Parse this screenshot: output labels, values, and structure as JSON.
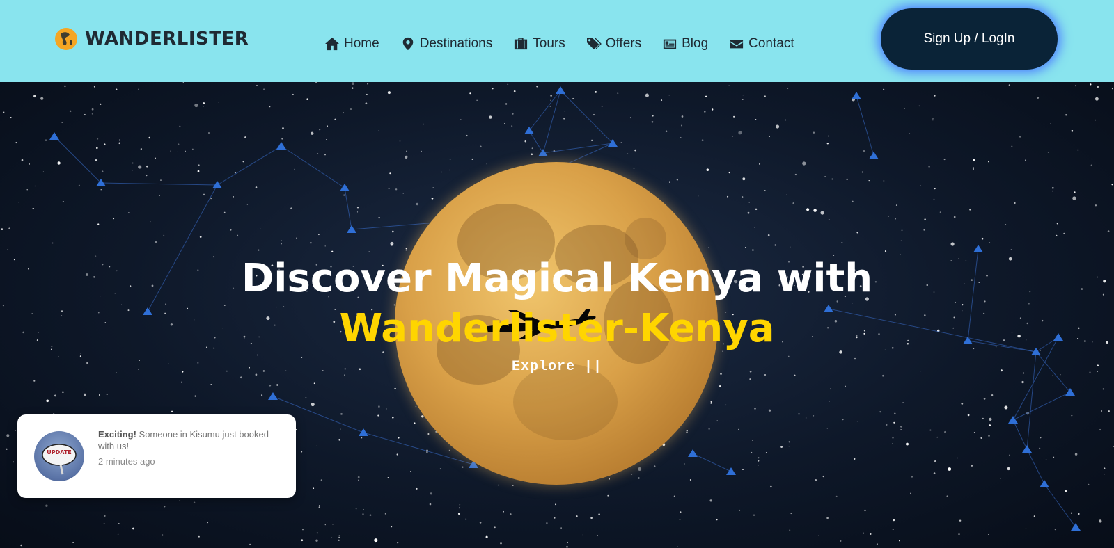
{
  "brand": {
    "name": "WANDERLISTER",
    "logo_icon": "globe-icon",
    "accent_color": "#f5a623"
  },
  "nav": {
    "items": [
      {
        "label": "Home",
        "icon": "home-icon"
      },
      {
        "label": "Destinations",
        "icon": "map-marker-icon"
      },
      {
        "label": "Tours",
        "icon": "suitcase-icon"
      },
      {
        "label": "Offers",
        "icon": "tags-icon"
      },
      {
        "label": "Blog",
        "icon": "newspaper-icon"
      },
      {
        "label": "Contact",
        "icon": "envelope-icon"
      }
    ]
  },
  "auth": {
    "signup_label": "Sign Up / LogIn"
  },
  "hero": {
    "headline": "Discover Magical Kenya with",
    "highlight": "Wanderlister-Kenya",
    "explore": "Explore ||",
    "highlight_color": "#ffd500"
  },
  "notification": {
    "badge": "UPDATE",
    "bold": "Exciting!",
    "message": " Someone in Kisumu just booked with us!",
    "time": "2 minutes ago"
  }
}
